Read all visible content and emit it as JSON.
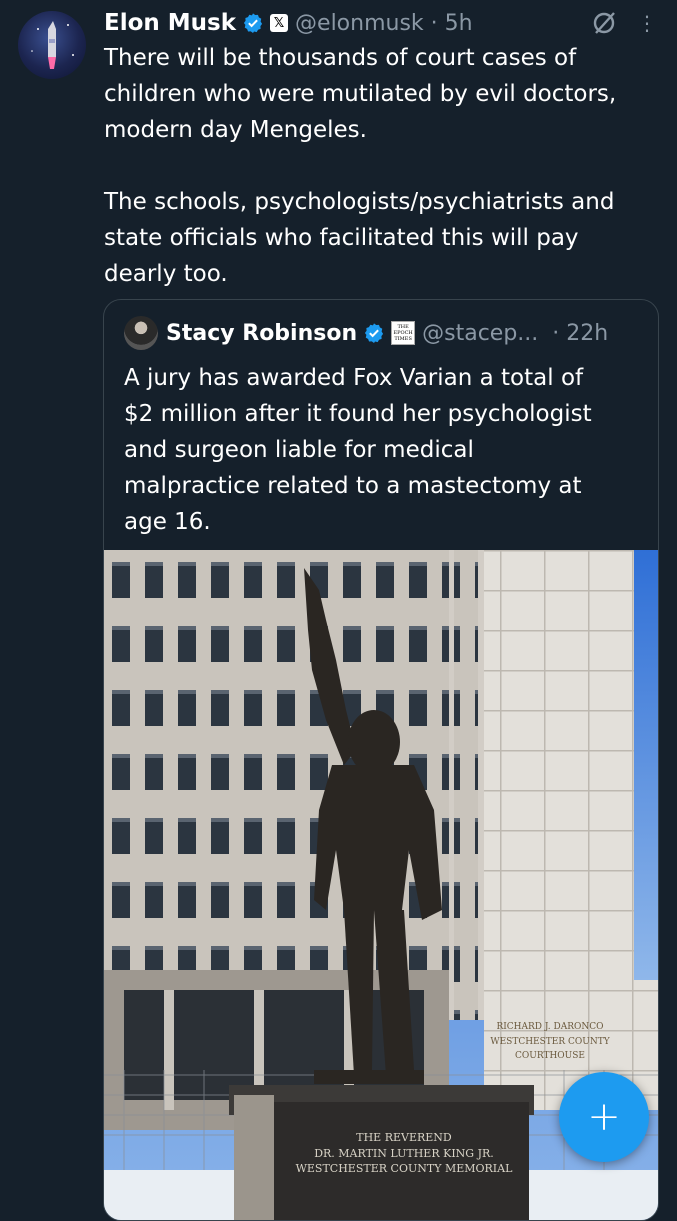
{
  "tweet": {
    "author_name": "Elon Musk",
    "author_handle": "@elonmusk",
    "separator": "·",
    "time": "5h",
    "text": "There will be thousands of court cases of\nchildren who were mutilated by evil doctors,\nmodern day Mengeles.\n\nThe schools, psychologists/psychiatrists and\nstate officials who facilitated this will pay\ndearly too.",
    "badge_icons": [
      "verified-icon",
      "x-affiliate-badge-icon"
    ],
    "actions": [
      "grok-icon",
      "more-options-icon"
    ]
  },
  "quote": {
    "author_name": "Stacy Robinson",
    "author_handle": "@stacep...",
    "time": "· 22h",
    "affiliate_badge_text": "THE EPOCH TIMES",
    "text": "A jury has awarded Fox Varian a total of\n$2 million after it found her psychologist\nand surgeon liable for medical\nmalpractice related to a mastectomy at\nage 16.",
    "photo": {
      "building_sign": [
        "RICHARD J. DARONCO",
        "WESTCHESTER COUNTY",
        "COURTHOUSE"
      ],
      "plaque": [
        "THE REVEREND",
        "DR. MARTIN LUTHER KING JR.",
        "WESTCHESTER COUNTY MEMORIAL"
      ]
    }
  },
  "compose": {
    "icon": "plus-icon",
    "label": "+"
  },
  "colors": {
    "background": "#15202b",
    "accent": "#1d9bf0",
    "secondary_text": "#8b98a5",
    "border": "#38444d"
  }
}
